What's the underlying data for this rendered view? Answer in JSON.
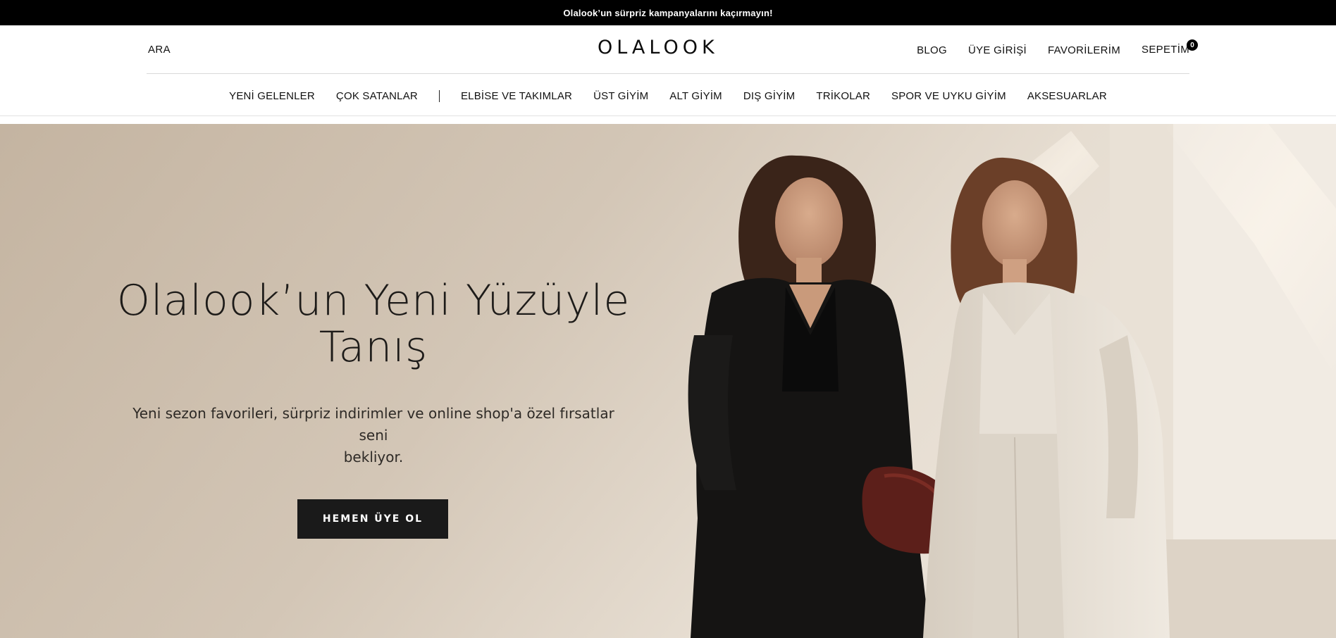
{
  "announcement": {
    "text": "Olalook’un sürpriz kampanyalarını kaçırmayın!"
  },
  "header": {
    "search_label": "ARA",
    "logo": "OLALOOK",
    "utility_links": [
      {
        "label": "BLOG"
      },
      {
        "label": "ÜYE GİRİŞİ"
      },
      {
        "label": "FAVORİLERİM"
      },
      {
        "label": "SEPETİM"
      }
    ],
    "cart_count": "0"
  },
  "nav": {
    "items": [
      {
        "label": "YENİ GELENLER"
      },
      {
        "label": "ÇOK SATANLAR"
      },
      {
        "label": "ELBİSE VE TAKIMLAR"
      },
      {
        "label": "ÜST GİYİM"
      },
      {
        "label": "ALT GİYİM"
      },
      {
        "label": "DIŞ GİYİM"
      },
      {
        "label": "TRİKOLAR"
      },
      {
        "label": "SPOR VE UYKU GİYİM"
      },
      {
        "label": "AKSESUARLAR"
      }
    ]
  },
  "hero": {
    "title_line1": "Olalook’un Yeni Yüzüyle",
    "title_line2": "Tanış",
    "subtitle_line1": "Yeni sezon favorileri, sürpriz indirimler ve online shop'a özel fırsatlar seni",
    "subtitle_line2": "bekliyor.",
    "cta_label": "HEMEN ÜYE OL"
  },
  "colors": {
    "announcement_bg": "#000000",
    "cta_bg": "#1a1a1a",
    "hero_bg": "#cdbfae",
    "text": "#111111"
  }
}
